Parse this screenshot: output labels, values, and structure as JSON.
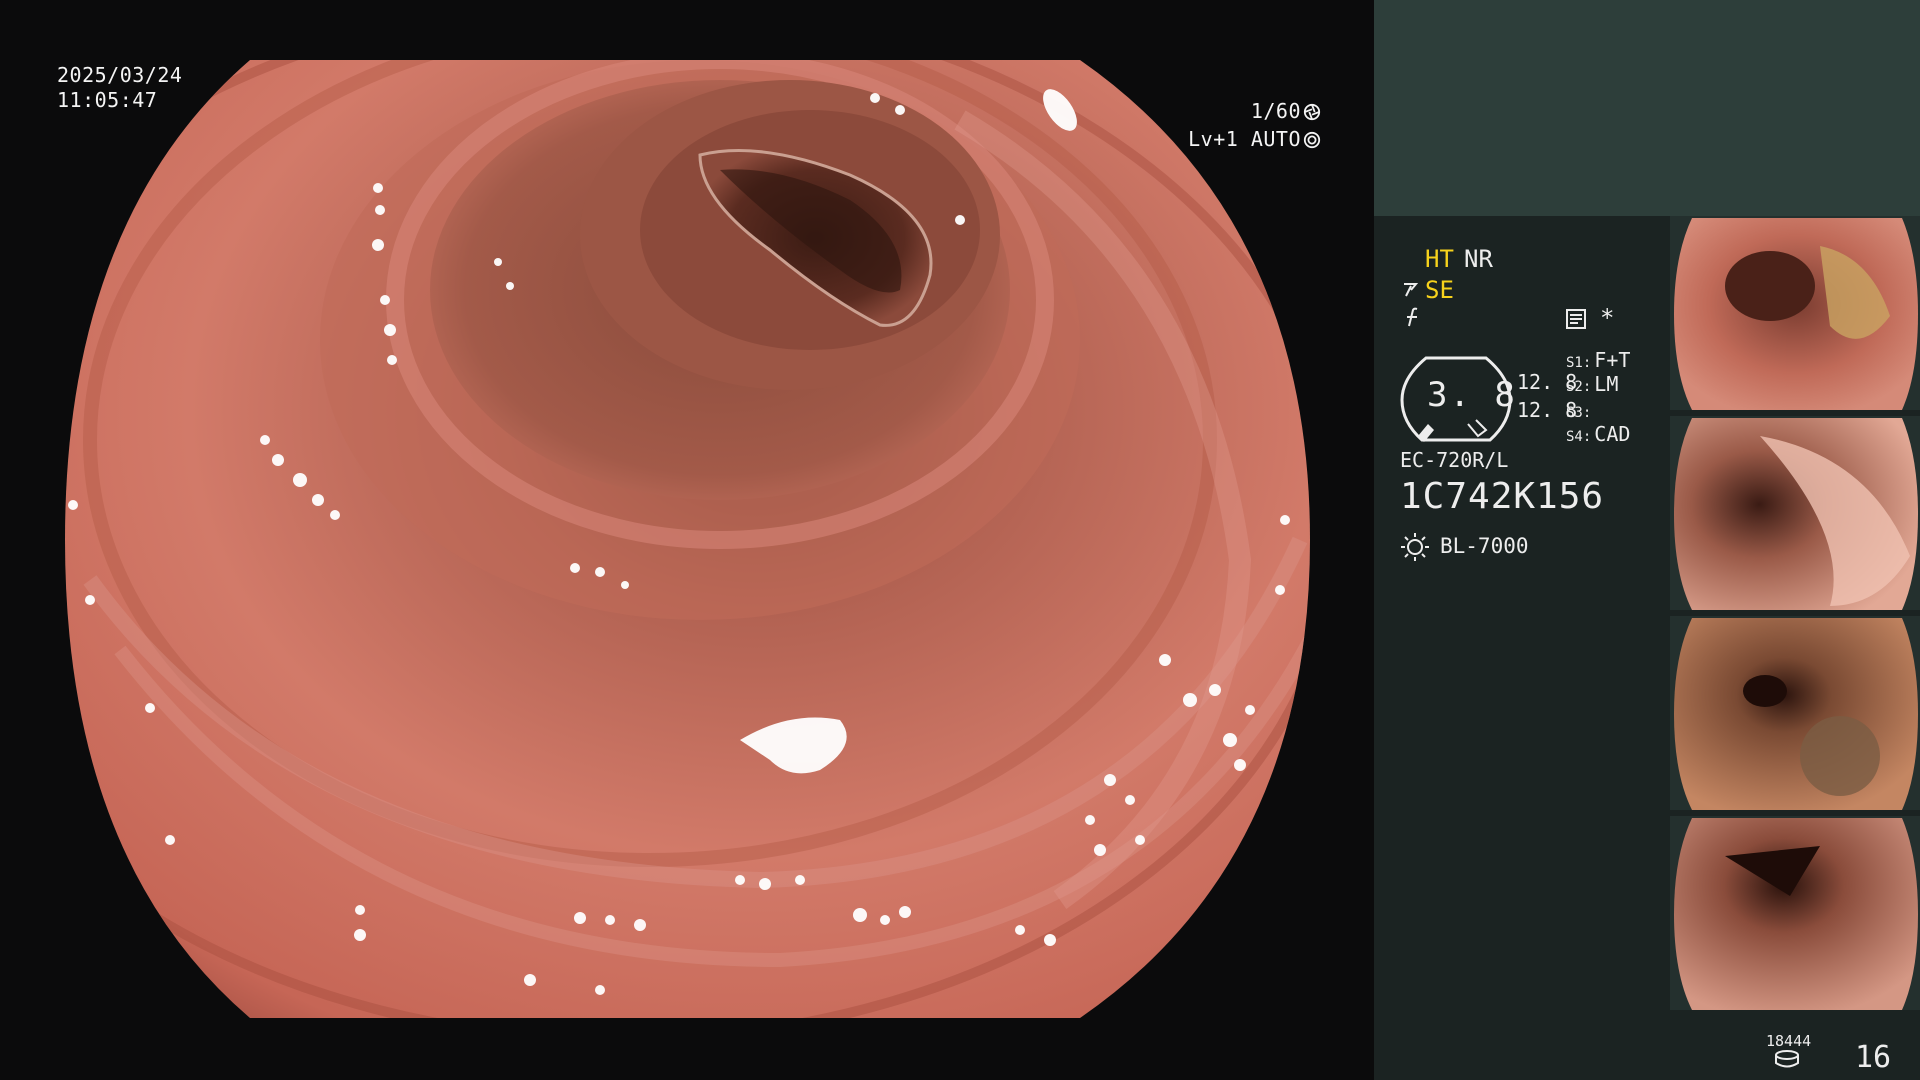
{
  "overlay": {
    "date": "2025/03/24",
    "time": "11:05:47",
    "shutter": "1/60",
    "level": "Lv+1",
    "iris_mode": "AUTO",
    "shutter_icon": "aperture-icon",
    "iris_icon": "iris-icon"
  },
  "panel": {
    "mode_ht": "HT",
    "mode_nr": "NR",
    "mode_se": "SE",
    "se_icon": "scope-angle-icon",
    "f_icon": "structure-enhance-icon",
    "memo_icon": "memo-icon",
    "star": "*",
    "gauge_value": "3. 8",
    "values": [
      "12. 8",
      "12. 8"
    ],
    "slots": [
      {
        "key": "S1:",
        "value": "F+T"
      },
      {
        "key": "S2:",
        "value": "LM"
      },
      {
        "key": "S3:",
        "value": ""
      },
      {
        "key": "S4:",
        "value": "CAD"
      }
    ],
    "model": "EC-720R/L",
    "serial": "1C742K156",
    "light_icon": "sun-icon",
    "light_source": "BL-7000",
    "image_count": "18444",
    "count_icon": "storage-disk-icon",
    "page_number": "16"
  },
  "thumbnails": [
    {
      "name": "thumbnail-1"
    },
    {
      "name": "thumbnail-2"
    },
    {
      "name": "thumbnail-3"
    },
    {
      "name": "thumbnail-4"
    }
  ],
  "colors": {
    "panel_bg": "#1b2322",
    "panel_top_band": "#2d3e3a",
    "highlight_yellow": "#f7d21c",
    "tissue": "#c86b5c"
  }
}
